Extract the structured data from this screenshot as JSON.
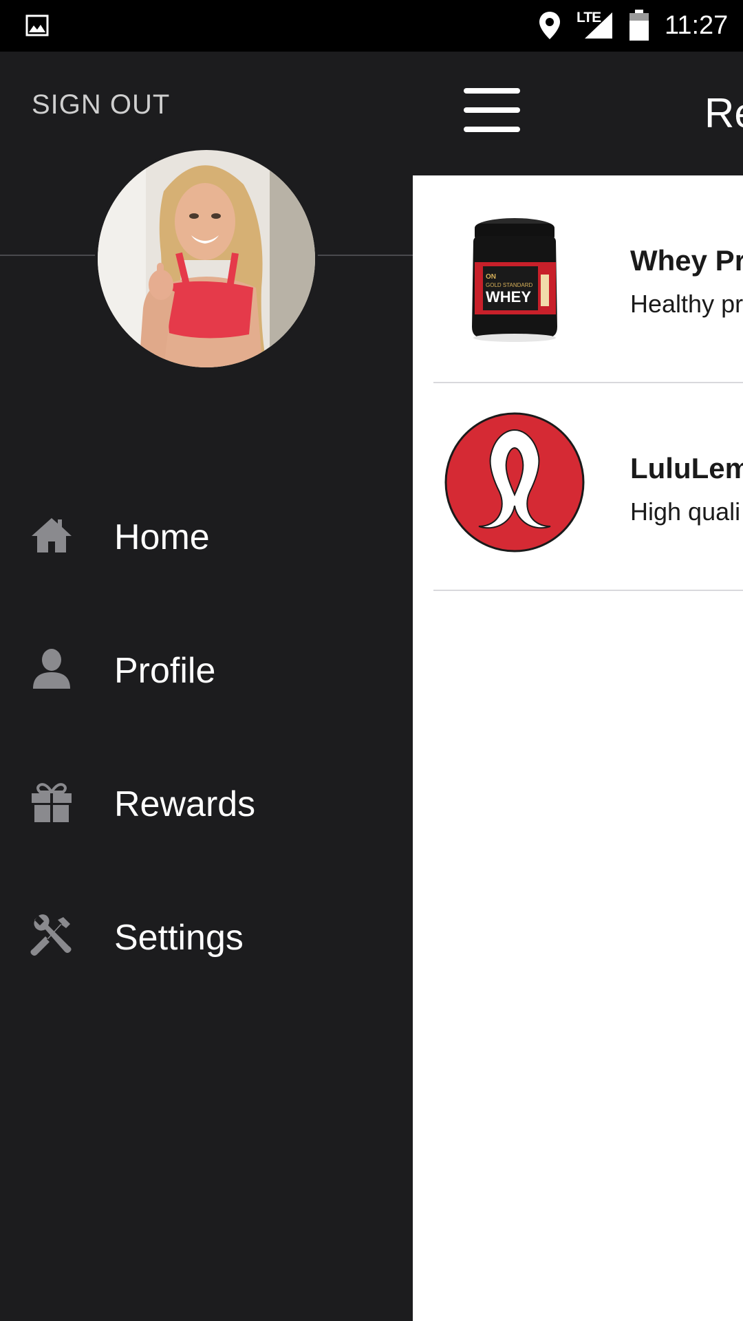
{
  "status_bar": {
    "time": "11:27",
    "network": "LTE",
    "icons": [
      "gallery-icon",
      "location-icon",
      "signal-icon",
      "battery-icon"
    ]
  },
  "main": {
    "title": "Re",
    "menu_icon": "hamburger-icon",
    "rewards": [
      {
        "title": "Whey Pr",
        "description": "Healthy pr",
        "image": "whey-protein-tub",
        "brand_text": "WHEY"
      },
      {
        "title": "LuluLem",
        "description": "High quali",
        "image": "lululemon-logo"
      }
    ]
  },
  "drawer": {
    "sign_out": "SIGN OUT",
    "avatar": "user-photo",
    "menu": [
      {
        "label": "Home",
        "icon": "home-icon"
      },
      {
        "label": "Profile",
        "icon": "person-icon"
      },
      {
        "label": "Rewards",
        "icon": "gift-icon"
      },
      {
        "label": "Settings",
        "icon": "wrench-screwdriver-icon"
      }
    ]
  },
  "colors": {
    "drawer_bg": "#1c1c1e",
    "status_bg": "#000000",
    "content_bg": "#ffffff",
    "icon_gray": "#8a8a8e",
    "lululemon_red": "#d52a34"
  }
}
